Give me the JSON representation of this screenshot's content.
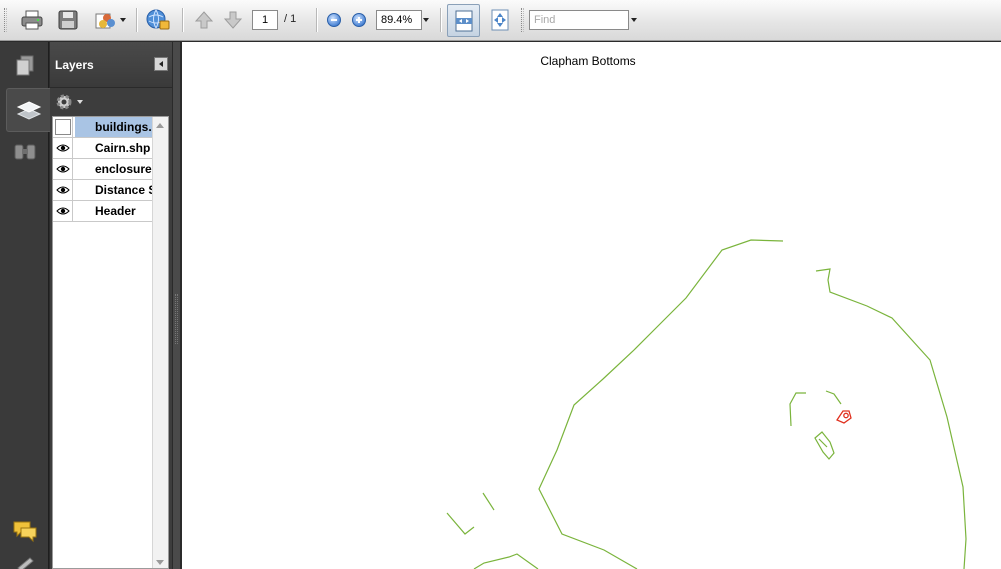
{
  "toolbar": {
    "page_current": "1",
    "page_total": "/ 1",
    "zoom": "89.4%",
    "find_placeholder": "Find",
    "icons": [
      "print-icon",
      "save-icon",
      "collaborate-icon",
      "secure-icon",
      "previous-page-icon",
      "next-page-icon",
      "zoom-out-icon",
      "zoom-in-icon",
      "fit-page-icon",
      "fit-width-icon"
    ]
  },
  "rail": {
    "items": [
      "pages-icon",
      "layers-icon",
      "attachments-icon",
      "comments-icon"
    ],
    "active": "layers-icon"
  },
  "layers": {
    "title": "Layers",
    "items": [
      {
        "name": "buildings.s",
        "visible": false,
        "selected": true
      },
      {
        "name": "Cairn.shp",
        "visible": true,
        "selected": false
      },
      {
        "name": "enclosures",
        "visible": true,
        "selected": false
      },
      {
        "name": "Distance S",
        "visible": true,
        "selected": false
      },
      {
        "name": "Header",
        "visible": true,
        "selected": false
      }
    ]
  },
  "document": {
    "title": "Clapham Bottoms",
    "colors": {
      "enclosure_line": "#7ab43c",
      "cairn_marker": "#e0301e"
    }
  },
  "colors": {
    "toolbar_bg": "#e4e4e4",
    "panel_bg": "#3d3d3d",
    "selection": "#a9c4e4"
  }
}
